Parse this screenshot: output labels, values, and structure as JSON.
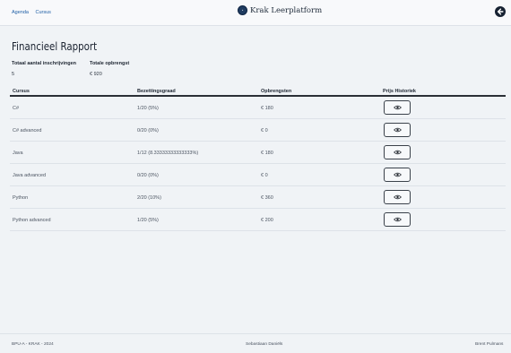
{
  "nav": {
    "links": [
      "Agenda",
      "Cursus"
    ],
    "brand": "Krak Leerplatform",
    "back_icon": "arrow-left-circle-icon"
  },
  "page": {
    "title": "Financieel Rapport"
  },
  "summary": {
    "total_enrollments_label": "Totaal aantal inschrijvingen",
    "total_enrollments_value": "5",
    "total_revenue_label": "Totale opbrengst",
    "total_revenue_value": "€ 920"
  },
  "table": {
    "headers": [
      "Cursus",
      "Bezettingsgraad",
      "Opbrengsten",
      "Prijs Historiek"
    ],
    "rows": [
      {
        "course": "C#",
        "occupancy": "1/20 (5%)",
        "revenue": "€ 180"
      },
      {
        "course": "C# advanced",
        "occupancy": "0/20 (0%)",
        "revenue": "€ 0"
      },
      {
        "course": "Java",
        "occupancy": "1/12 (8.33333333333333%)",
        "revenue": "€ 180"
      },
      {
        "course": "Java advanced",
        "occupancy": "0/20 (0%)",
        "revenue": "€ 0"
      },
      {
        "course": "Python",
        "occupancy": "2/20 (10%)",
        "revenue": "€ 360"
      },
      {
        "course": "Python advanced",
        "occupancy": "1/20 (5%)",
        "revenue": "€ 200"
      }
    ],
    "action_icon": "eye-icon"
  },
  "footer": {
    "left": "BPU-A - KRAK - 2024",
    "center": "Sebastiaan Daniëls",
    "right": "Brent Pulmans"
  }
}
